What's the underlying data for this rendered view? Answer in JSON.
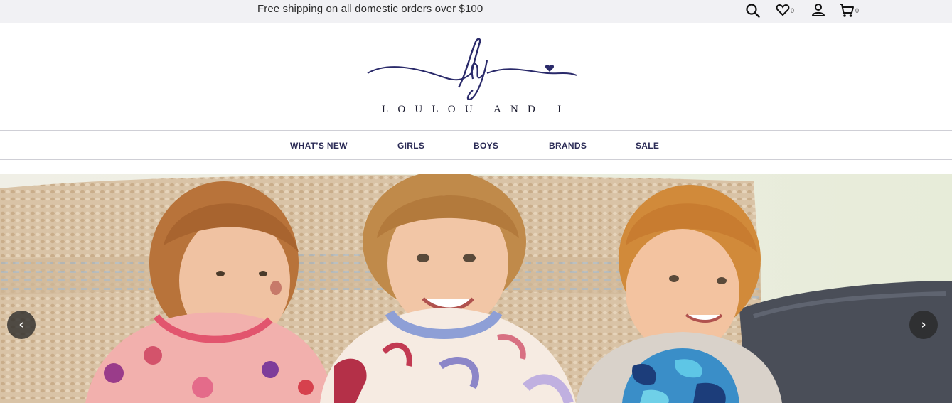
{
  "announcement": "Free shipping on all domestic orders over $100",
  "header_icons": {
    "search": "search-icon",
    "wishlist": "heart-icon",
    "wishlist_count": "0",
    "account": "user-icon",
    "cart": "cart-icon",
    "cart_count": "0"
  },
  "brand": {
    "monogram": "lj",
    "wordmark": "LouLou and j"
  },
  "nav": {
    "items": [
      {
        "label": "WHAT’S NEW"
      },
      {
        "label": "GIRLS"
      },
      {
        "label": "BOYS"
      },
      {
        "label": "BRANDS"
      },
      {
        "label": "SALE"
      }
    ]
  },
  "hero": {
    "prev_icon": "chevron-left-icon",
    "prev_glyph": "‹",
    "next_icon": "chevron-right-icon",
    "next_glyph": "›"
  },
  "colors": {
    "brand_navy": "#2a2a6a",
    "topbar_bg": "#f1f1f4",
    "nav_text": "#2a2a55"
  }
}
